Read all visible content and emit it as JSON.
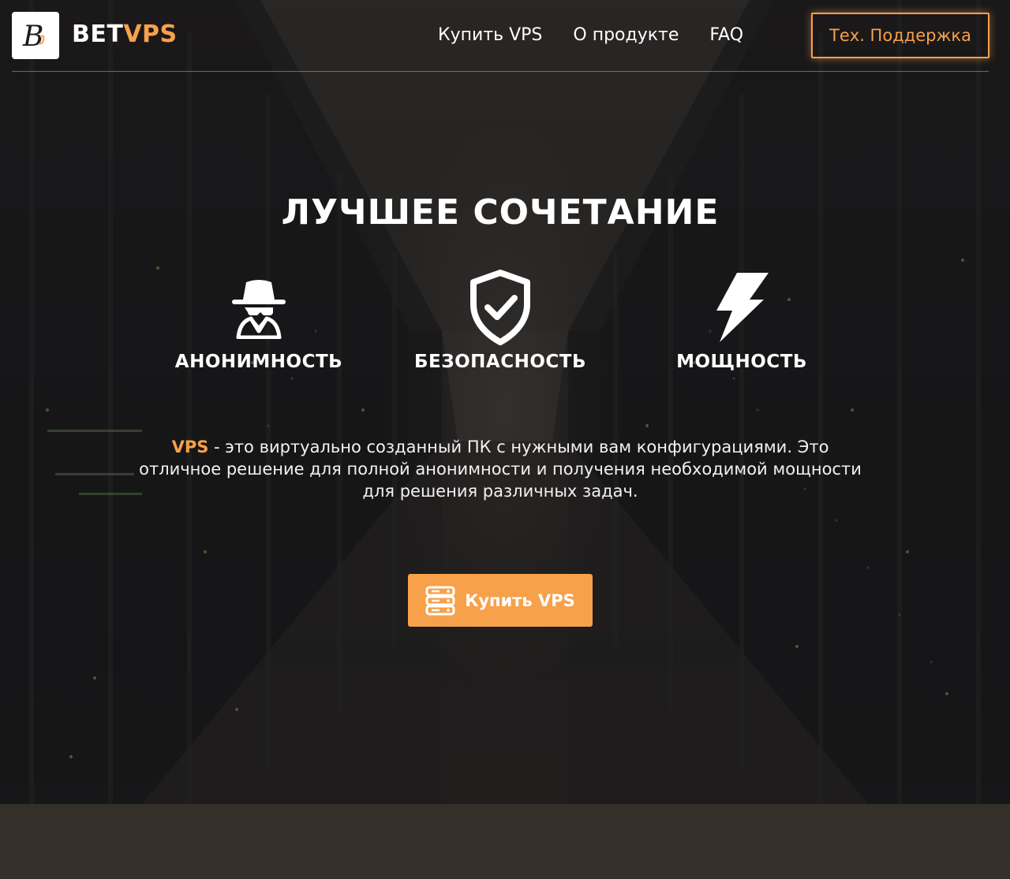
{
  "header": {
    "logo_letter": "B",
    "brand_part1": "BET",
    "brand_part2": "VPS",
    "nav": [
      {
        "label": "Купить VPS"
      },
      {
        "label": "О продукте"
      },
      {
        "label": "FAQ"
      }
    ],
    "support_label": "Тех. Поддержка"
  },
  "hero": {
    "title": "ЛУЧШЕЕ СОЧЕТАНИЕ",
    "features": [
      {
        "label": "АНОНИМНОСТЬ",
        "icon": "spy-icon"
      },
      {
        "label": "БЕЗОПАСНОСТЬ",
        "icon": "shield-check-icon"
      },
      {
        "label": "МОЩНОСТЬ",
        "icon": "lightning-icon"
      }
    ],
    "desc_highlight": "VPS",
    "desc_text": " - это виртуально созданный ПК с нужными вам конфигурациями. Это отличное решение для полной анонимности и получения необходимой мощности для решения различных задач.",
    "buy_label": "Купить VPS",
    "buy_icon": "server-icon"
  },
  "colors": {
    "accent": "#f7a14a",
    "text": "#ffffff"
  }
}
